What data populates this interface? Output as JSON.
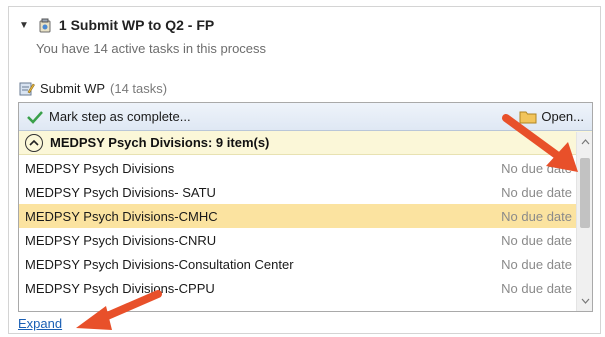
{
  "process": {
    "title": "1 Submit WP to Q2 - FP",
    "subtitle": "You have 14 active tasks in this process"
  },
  "step": {
    "title": "Submit WP",
    "count": "(14 tasks)"
  },
  "toolbar": {
    "mark_complete": "Mark step as complete...",
    "open": "Open..."
  },
  "group": {
    "label": "MEDPSY Psych Divisions: 9 item(s)"
  },
  "rows": [
    {
      "name": "MEDPSY Psych Divisions",
      "due": "No due date"
    },
    {
      "name": "MEDPSY Psych Divisions- SATU",
      "due": "No due date"
    },
    {
      "name": "MEDPSY Psych Divisions-CMHC",
      "due": "No due date"
    },
    {
      "name": "MEDPSY Psych Divisions-CNRU",
      "due": "No due date"
    },
    {
      "name": "MEDPSY Psych Divisions-Consultation Center",
      "due": "No due date"
    },
    {
      "name": "MEDPSY Psych Divisions-CPPU",
      "due": "No due date"
    }
  ],
  "expand_label": "Expand",
  "colors": {
    "selected_row": "#fbe3a0",
    "group_row": "#fbf7d8",
    "annotation_arrow": "#e8502a",
    "link": "#1a5fb4"
  },
  "icons": {
    "process": "workflow-icon",
    "step": "form-edit-icon",
    "mark_complete": "checkmark-icon",
    "open": "folder-icon"
  }
}
